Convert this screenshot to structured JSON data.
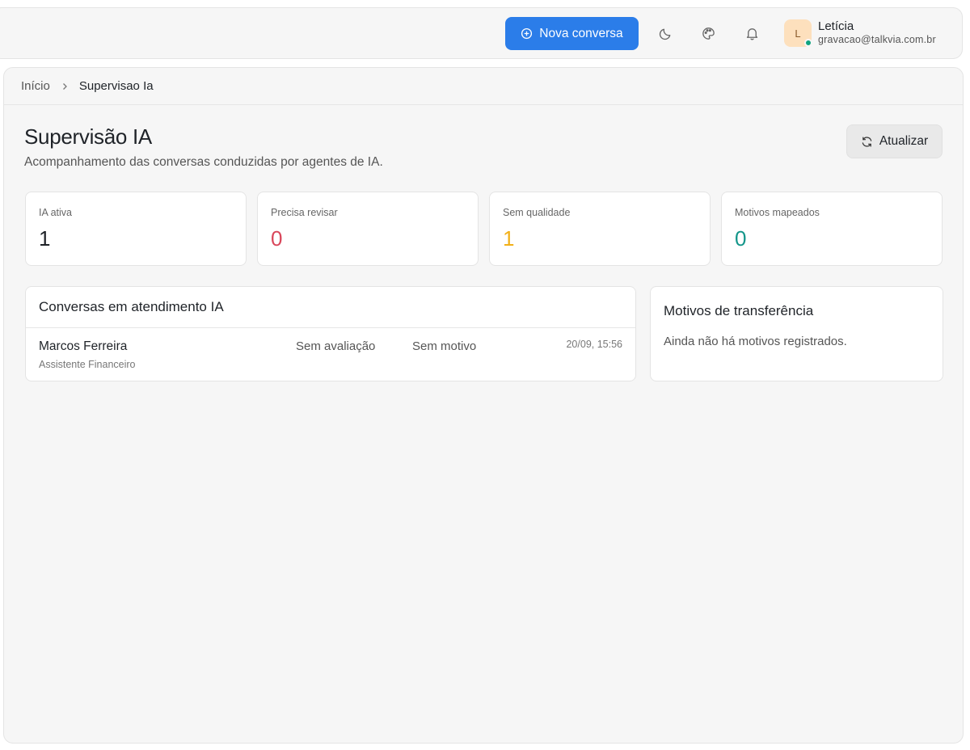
{
  "header": {
    "new_conversation_label": "Nova conversa",
    "icons": [
      "plus-circle-icon",
      "moon-icon",
      "palette-icon",
      "bell-icon"
    ],
    "user": {
      "initial": "L",
      "name": "Letícia",
      "email": "gravacao@talkvia.com.br",
      "status_color": "#10a37f"
    }
  },
  "breadcrumb": {
    "home": "Início",
    "current": "Supervisao Ia"
  },
  "page": {
    "title": "Supervisão IA",
    "subtitle": "Acompanhamento das conversas conduzidas por agentes de IA.",
    "refresh_label": "Atualizar"
  },
  "stats": [
    {
      "label": "IA ativa",
      "value": "1",
      "color": "#1f2328"
    },
    {
      "label": "Precisa revisar",
      "value": "0",
      "color": "#d9475b"
    },
    {
      "label": "Sem qualidade",
      "value": "1",
      "color": "#f2b019"
    },
    {
      "label": "Motivos mapeados",
      "value": "0",
      "color": "#14968a"
    }
  ],
  "conversations": {
    "title": "Conversas em atendimento IA",
    "rows": [
      {
        "name": "Marcos Ferreira",
        "agent": "Assistente Financeiro",
        "rating": "Sem avaliação",
        "reason": "Sem motivo",
        "time": "20/09, 15:56"
      }
    ]
  },
  "transfer_reasons": {
    "title": "Motivos de transferência",
    "empty_text": "Ainda não há motivos registrados."
  },
  "colors": {
    "accent": "#2b7de9"
  }
}
